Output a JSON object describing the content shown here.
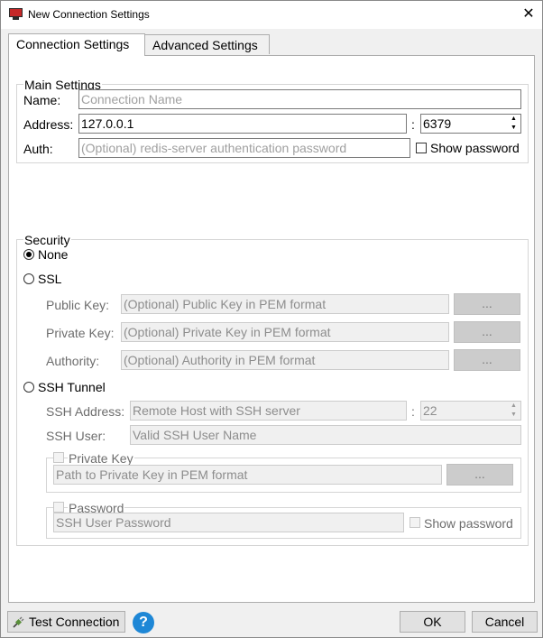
{
  "window": {
    "title": "New Connection Settings",
    "close": "✕"
  },
  "tabs": [
    {
      "label": "Connection Settings"
    },
    {
      "label": "Advanced Settings"
    }
  ],
  "main": {
    "legend": "Main Settings",
    "name_label": "Name:",
    "name_placeholder": "Connection Name",
    "address_label": "Address:",
    "address_value": "127.0.0.1",
    "port_sep": ":",
    "port_value": "6379",
    "auth_label": "Auth:",
    "auth_placeholder": "(Optional) redis-server authentication password",
    "show_password": "Show password"
  },
  "security": {
    "legend": "Security",
    "none_label": "None",
    "ssl_label": "SSL",
    "public_key_label": "Public Key:",
    "public_key_placeholder": "(Optional) Public Key in PEM format",
    "private_key_label": "Private Key:",
    "private_key_placeholder": "(Optional) Private Key in PEM format",
    "authority_label": "Authority:",
    "authority_placeholder": "(Optional) Authority in PEM format",
    "browse": "...",
    "ssh_label": "SSH Tunnel",
    "ssh_address_label": "SSH Address:",
    "ssh_address_placeholder": "Remote Host with SSH server",
    "ssh_port_sep": ":",
    "ssh_port_value": "22",
    "ssh_user_label": "SSH User:",
    "ssh_user_placeholder": "Valid SSH User Name",
    "private_key_group": "Private Key",
    "private_key_path_placeholder": "Path to Private Key in PEM format",
    "password_group": "Password",
    "ssh_password_placeholder": "SSH User Password",
    "ssh_show_password": "Show password"
  },
  "footer": {
    "test_connection": "Test Connection",
    "help": "?",
    "ok": "OK",
    "cancel": "Cancel"
  },
  "colors": {
    "accent": "#1e87d6",
    "disabled_button": "#cccccc",
    "panel": "#ffffff",
    "chrome": "#f0f0f0"
  }
}
